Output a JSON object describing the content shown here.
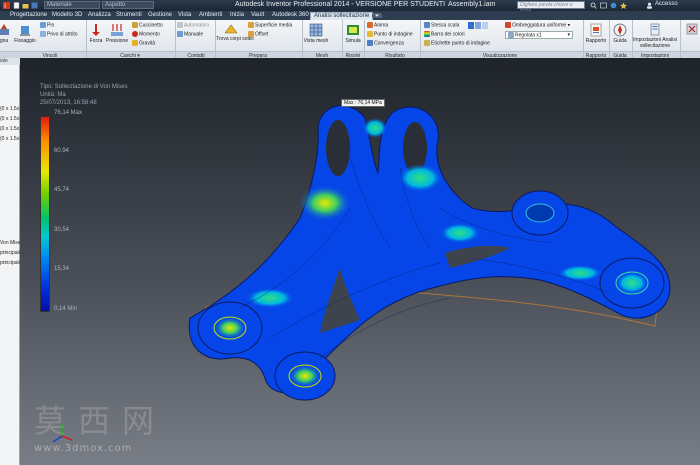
{
  "window": {
    "title": "Autodesk Inventor Professional 2014 - VERSIONE PER STUDENTI",
    "document": "Assembly1.iam",
    "material_combo": "Materiale",
    "appearance_combo": "Aspetto",
    "search_placeholder": "Digitare parola chiave o frase",
    "access_label": "Accesso"
  },
  "tabs": [
    "Progettazione",
    "Modello 3D",
    "Analizza",
    "Strumenti",
    "Gestione",
    "Vista",
    "Ambienti",
    "Inizia",
    "Vault",
    "Autodesk 360",
    "Analisi sollecitazione"
  ],
  "active_tab": "Analisi sollecitazione",
  "ribbon": {
    "vincoli": {
      "fissaggio": "Fissaggio",
      "pin": "Pin",
      "privo_attrito": "Privo di attrito",
      "label": "Vincoli"
    },
    "carichi": {
      "forza": "Forza",
      "pressione": "Pressione",
      "cuscinetto": "Cuscinetto",
      "momento": "Momento",
      "gravita": "Gravità",
      "label": "Carichi ▾"
    },
    "contatti": {
      "automatico": "Automatico",
      "manuale": "Manuale",
      "label": "Contatti"
    },
    "prepara": {
      "trova": "Trova corpi sottili",
      "superficie": "Superficie media",
      "offset": "Offset",
      "label": "Prepara"
    },
    "mesh": {
      "vista_mesh": "Vista mesh",
      "label": "Mesh"
    },
    "risolvi": {
      "simula": "Simula",
      "label": "Risolvi"
    },
    "risultato": {
      "anima": "Anima",
      "punto": "Punto di indagine",
      "convergenza": "Convergenza",
      "label": "Risultato"
    },
    "visualizzazione": {
      "stessa_scala": "Stessa scala",
      "barra_colori": "Barra dei colori",
      "etichette": "Etichette punto di indagine",
      "ombreggiatura": "Ombreggiatura uniforme",
      "regolata": "Regolata x1",
      "label": "Visualizzazione"
    },
    "rapporto": {
      "rapporto": "Rapporto",
      "label": "Rapporto"
    },
    "guida": {
      "guida": "Guida",
      "label": "Guida"
    },
    "impostazioni": {
      "impostazioni": "Impostazioni Analisi sollecitazione",
      "label": "Impostazioni"
    }
  },
  "browser": {
    "items": [
      "(0 x 1.5x16)",
      "(0 x 1.5x16)",
      "(0 x 1.5x16)",
      "(0 x 1.5x16)",
      "Von Mises",
      "principale",
      "principale"
    ],
    "header": "iale"
  },
  "legend": {
    "type_line": "Tipo: Sollecitazione di Von Mises",
    "unit_line": "Unità: Ma",
    "date_line": "25/07/2013, 16:58:48",
    "max_label": "76,14 Max",
    "ticks": [
      "60,94",
      "45,74",
      "30,54",
      "15,34"
    ],
    "min_label": "0,14 Min"
  },
  "probe": "Max : 76,14 MPa",
  "watermark": {
    "chars": "莫西网",
    "url": "www.3dmox.com"
  }
}
